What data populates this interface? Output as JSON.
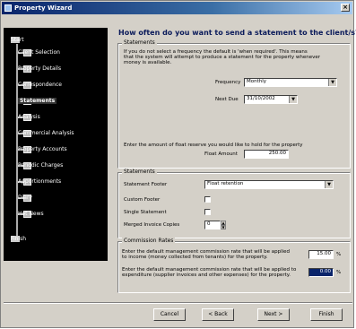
{
  "window": {
    "title": "Property Wizard",
    "close_glyph": "×"
  },
  "nav": {
    "start_label": "Start",
    "finish_label": "Finish",
    "items": [
      {
        "label": "Client Selection"
      },
      {
        "label": "Property Details"
      },
      {
        "label": "Correspondence"
      },
      {
        "label": "Statements"
      },
      {
        "label": "Analysis"
      },
      {
        "label": "Commercial Analysis"
      },
      {
        "label": "Property Accounts"
      },
      {
        "label": "Periodic Charges"
      },
      {
        "label": "Apportionments"
      },
      {
        "label": "Diary"
      },
      {
        "label": "Hot News"
      }
    ],
    "active_index": 3
  },
  "heading": "How often do you want to send a statement to the client/s?",
  "statements_section": {
    "title": "Statements",
    "description_lines": [
      "If you do not select a frequency the default is 'when required'. This means",
      "that the system will attempt to produce a statement for the property whenever",
      "money is available."
    ],
    "frequency_label": "Frequency",
    "frequency_value": "Monthly",
    "next_due_label": "Next Due",
    "next_due_value": "31/10/2002",
    "float_desc": "Enter the amount of float reserve you would like to hold for the property",
    "float_label": "Float Amount",
    "float_value": "250.00"
  },
  "statements_options": {
    "title": "Statements",
    "footer_label": "Statement Footer",
    "footer_value": "Float retention",
    "custom_footer_label": "Custom Footer",
    "single_statement_label": "Single Statement",
    "invoice_copies_label": "Merged Invoice Copies",
    "invoice_copies_value": "0"
  },
  "commission_section": {
    "title": "Commission Rates",
    "income_lines": [
      "Enter the default management commission rate that will be applied",
      "to income (money collected from tenants) for the property."
    ],
    "income_value": "15.00",
    "expenditure_lines": [
      "Enter the default management commission rate that will be applied to",
      "expenditure (supplier invoices and other expenses) for the property."
    ],
    "expenditure_value": "0.00",
    "percent_sign": "%"
  },
  "buttons": {
    "cancel": "Cancel",
    "back": "< Back",
    "next": "Next >",
    "finish": "Finish"
  },
  "colors": {
    "titlebar_start": "#0a246a",
    "nav_bg": "#000000",
    "heading": "#0a1a5a"
  }
}
